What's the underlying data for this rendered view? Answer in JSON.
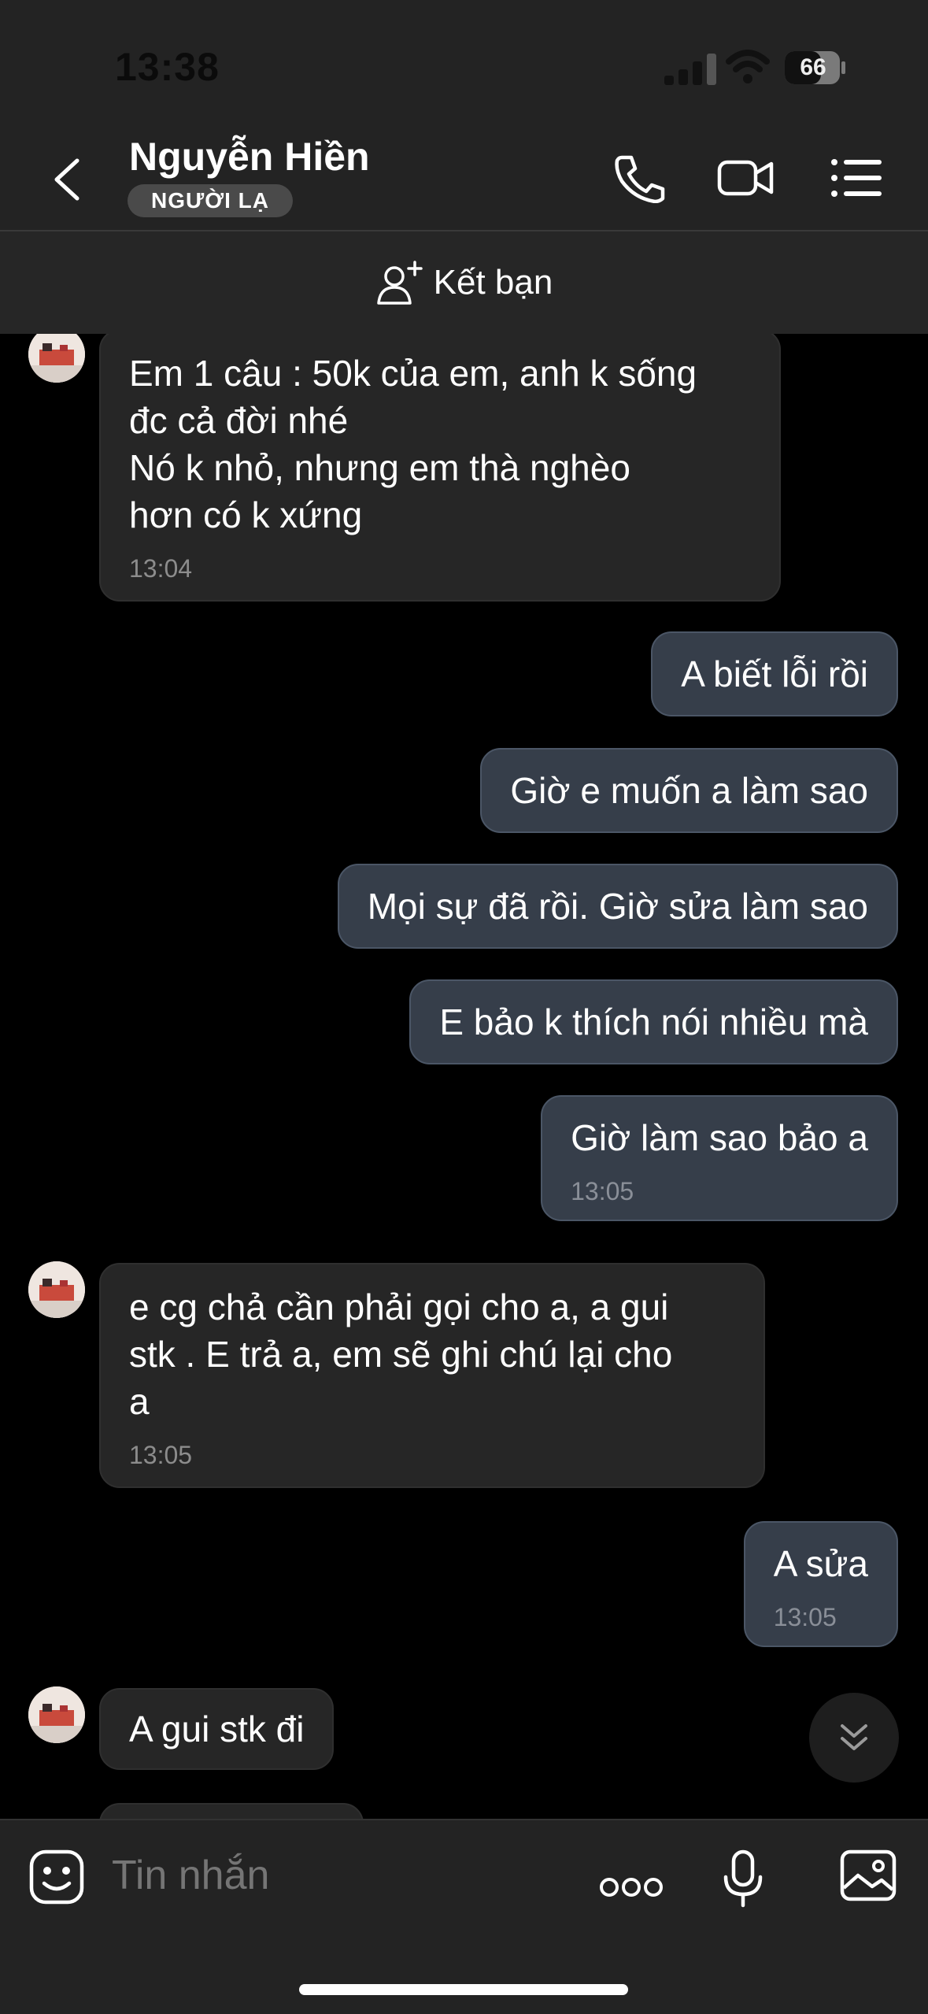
{
  "status": {
    "time": "13:38",
    "battery": "66"
  },
  "header": {
    "contact_name": "Nguyễn Hiền",
    "badge": "NGƯỜI LẠ",
    "icons": [
      "back-chevron-icon",
      "phone-icon",
      "video-call-icon",
      "menu-list-icon"
    ]
  },
  "friend_bar": {
    "label": "Kết bạn",
    "icon": "add-friend-icon"
  },
  "messages": [
    {
      "side": "received",
      "lines": [
        "Em 1 câu : 50k của em, anh k sống",
        "đc cả đời nhé",
        "Nó k nhỏ, nhưng em thà nghèo",
        "hơn có k xứng"
      ],
      "time": "13:04"
    },
    {
      "side": "sent",
      "text": "A biết lỗi rồi"
    },
    {
      "side": "sent",
      "text": "Giờ e muốn a làm sao"
    },
    {
      "side": "sent",
      "text": "Mọi sự đã rồi. Giờ sửa làm sao"
    },
    {
      "side": "sent",
      "text": "E bảo k thích nói nhiều mà"
    },
    {
      "side": "sent",
      "text": "Giờ làm sao bảo a",
      "time": "13:05"
    },
    {
      "side": "received",
      "lines": [
        "e cg chả cần phải gọi cho a, a gui",
        "stk . E trả a, em sẽ ghi chú lại cho",
        "a"
      ],
      "time": "13:05"
    },
    {
      "side": "sent",
      "text": "A sửa",
      "time": "13:05"
    },
    {
      "side": "received",
      "text": "A gui stk đi"
    }
  ],
  "composer": {
    "placeholder": "Tin nhắn",
    "icons": [
      "sticker-icon",
      "more-icon",
      "microphone-icon",
      "image-icon"
    ]
  },
  "colors": {
    "background": "#000000",
    "bar": "#232323",
    "received_bubble": "#262626",
    "sent_bubble": "#363e4a"
  }
}
